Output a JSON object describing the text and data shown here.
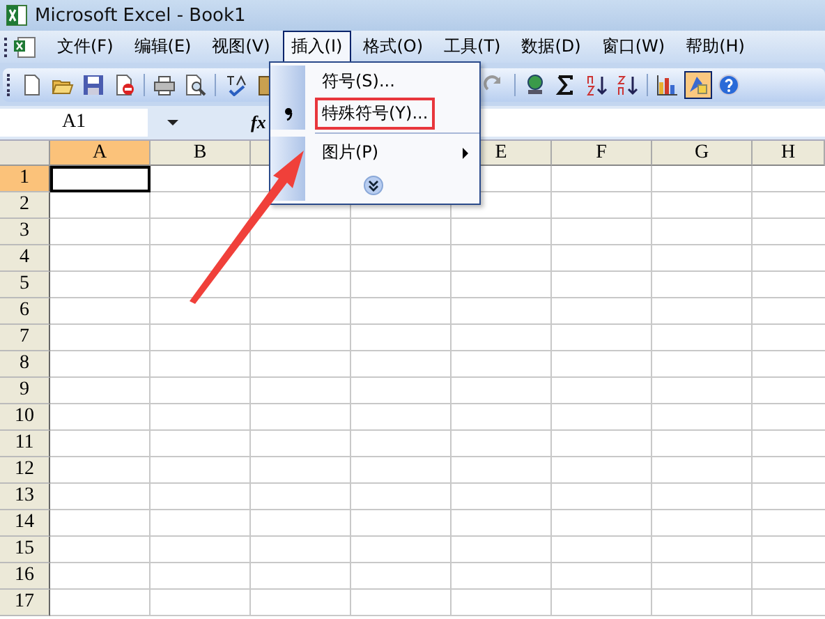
{
  "window": {
    "title": "Microsoft Excel - Book1"
  },
  "menu_bar": [
    {
      "label": "文件(F)",
      "selected": false
    },
    {
      "label": "编辑(E)",
      "selected": false
    },
    {
      "label": "视图(V)",
      "selected": false
    },
    {
      "label": "插入(I)",
      "selected": true
    },
    {
      "label": "格式(O)",
      "selected": false
    },
    {
      "label": "工具(T)",
      "selected": false
    },
    {
      "label": "数据(D)",
      "selected": false
    },
    {
      "label": "窗口(W)",
      "selected": false
    },
    {
      "label": "帮助(H)",
      "selected": false
    }
  ],
  "toolbar_left": [
    {
      "kind": "new",
      "on": false
    },
    {
      "kind": "open",
      "on": false
    },
    {
      "kind": "save",
      "on": false
    },
    {
      "kind": "permission",
      "on": false
    },
    {
      "kind": "sep"
    },
    {
      "kind": "print",
      "on": false
    },
    {
      "kind": "preview",
      "on": false
    },
    {
      "kind": "sep"
    },
    {
      "kind": "spelling",
      "on": false
    },
    {
      "kind": "research",
      "on": false
    }
  ],
  "toolbar_right": [
    {
      "kind": "undo",
      "on": false
    },
    {
      "kind": "sep"
    },
    {
      "kind": "hyperlink",
      "on": false
    },
    {
      "kind": "sum",
      "on": false
    },
    {
      "kind": "sortasc",
      "on": false
    },
    {
      "kind": "sortdesc",
      "on": false
    },
    {
      "kind": "sep"
    },
    {
      "kind": "chart",
      "on": false
    },
    {
      "kind": "drawing",
      "on": true
    },
    {
      "kind": "help",
      "on": false
    }
  ],
  "formula_bar": {
    "name_box": "A1",
    "fx": "fx"
  },
  "sheet": {
    "columns": [
      {
        "kind": "header",
        "label": "A",
        "selected": true
      },
      {
        "kind": "header",
        "label": "B",
        "selected": false
      },
      {
        "kind": "covered"
      },
      {
        "kind": "covered"
      },
      {
        "kind": "header",
        "label": "E",
        "selected": false
      },
      {
        "kind": "header",
        "label": "F",
        "selected": false
      },
      {
        "kind": "header",
        "label": "G",
        "selected": false
      },
      {
        "kind": "header",
        "label": "H",
        "selected": false
      }
    ],
    "rows": [
      {
        "label": "1",
        "selected": true
      },
      {
        "label": "2",
        "selected": false
      },
      {
        "label": "3",
        "selected": false
      },
      {
        "label": "4",
        "selected": false
      },
      {
        "label": "5",
        "selected": false
      },
      {
        "label": "6",
        "selected": false
      },
      {
        "label": "7",
        "selected": false
      },
      {
        "label": "8",
        "selected": false
      },
      {
        "label": "9",
        "selected": false
      },
      {
        "label": "10",
        "selected": false
      },
      {
        "label": "11",
        "selected": false
      },
      {
        "label": "12",
        "selected": false
      },
      {
        "label": "13",
        "selected": false
      },
      {
        "label": "14",
        "selected": false
      },
      {
        "label": "15",
        "selected": false
      },
      {
        "label": "16",
        "selected": false
      },
      {
        "label": "17",
        "selected": false
      }
    ]
  },
  "insert_menu": {
    "items": [
      {
        "kind": "command",
        "label": "符号(S)...",
        "has_icon": false,
        "annotated": false
      },
      {
        "kind": "command",
        "label": "特殊符号(Y)...",
        "has_icon": true,
        "annotated": true
      },
      {
        "kind": "separator"
      },
      {
        "kind": "submenu",
        "label": "图片(P)",
        "has_icon": false,
        "annotated": false
      },
      {
        "kind": "expand"
      }
    ]
  },
  "annotation": {
    "arrow": true
  }
}
